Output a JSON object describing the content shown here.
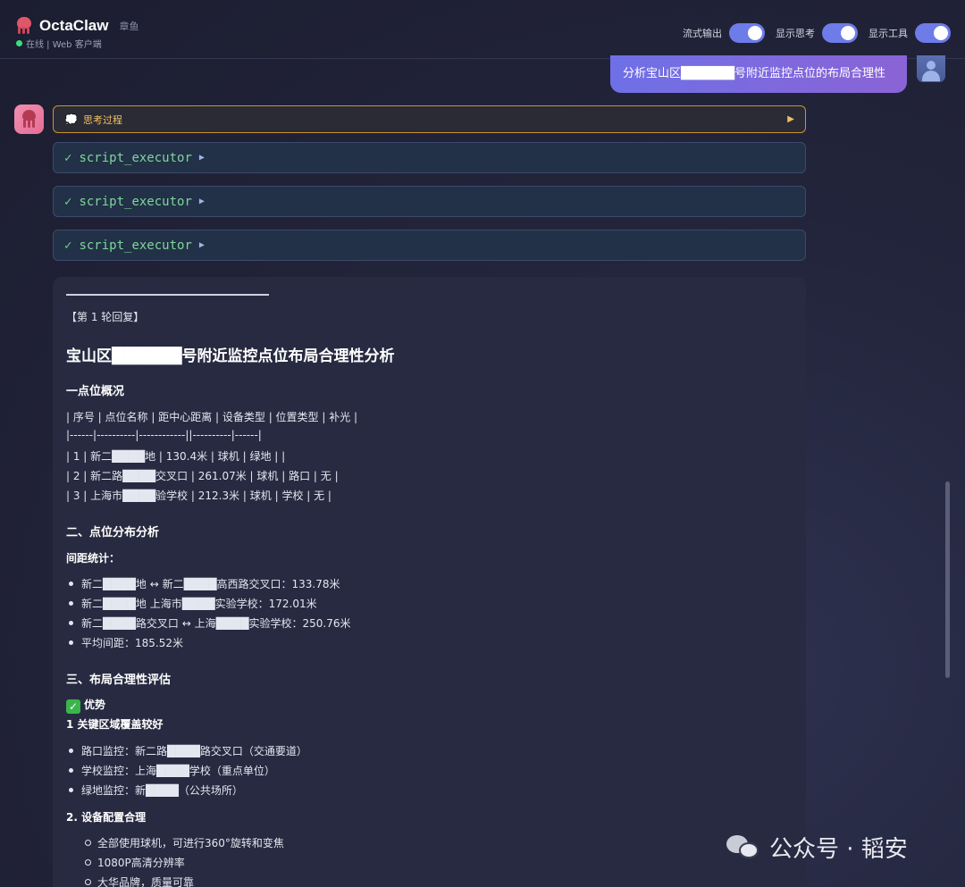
{
  "header": {
    "title": "OctaClaw",
    "subtitle": "章鱼",
    "status": "在线 | Web 客户端",
    "toggles": [
      {
        "label": "流式输出",
        "on": true
      },
      {
        "label": "显示思考",
        "on": true
      },
      {
        "label": "显示工具",
        "on": true
      }
    ]
  },
  "user_message": {
    "text": "分析宝山区██████号附近监控点位的布局合理性"
  },
  "thinking": {
    "label": "思考过程",
    "arrow": "▶"
  },
  "tools": [
    {
      "check": "✓",
      "name": "script_executor",
      "arrow": "▶"
    },
    {
      "check": "✓",
      "name": "script_executor",
      "arrow": "▶"
    },
    {
      "check": "✓",
      "name": "script_executor",
      "arrow": "▶"
    }
  ],
  "response": {
    "round_label": "【第 1 轮回复】",
    "title": "宝山区██████号附近监控点位布局合理性分析",
    "section1": {
      "heading": "一点位概况",
      "table_lines": [
        "| 序号 | 点位名称 | 距中心距离 | 设备类型 | 位置类型 | 补光 |",
        "|------|----------|------------||----------|------|",
        "| 1 | 新二████地 | 130.4米 | 球机 | 绿地 | |",
        "| 2 | 新二路████交叉口 | 261.07米 | 球机 | 路口 | 无 |",
        "| 3 | 上海市████验学校 | 212.3米 | 球机 | 学校 | 无 |"
      ]
    },
    "section2": {
      "heading": "二、点位分布分析",
      "sub": "间距统计：",
      "items": [
        "新二████地 ↔ 新二████高西路交叉口：133.78米",
        "新二████地 上海市████实验学校：172.01米",
        "新二████路交叉口 ↔ 上海████实验学校：250.76米",
        "平均间距：185.52米"
      ]
    },
    "section3": {
      "heading": "三、布局合理性评估",
      "advantage_label": "优势",
      "sub1": "1 关键区域覆盖较好",
      "items1": [
        "路口监控：新二路████路交叉口（交通要道）",
        "学校监控：上海████学校（重点单位）",
        "绿地监控：新████（公共场所）"
      ],
      "sub2": "2.  设备配置合理",
      "items2": [
        "全部使用球机，可进行360°旋转和变焦",
        "1080P高清分辨率",
        "大华品牌，质量可靠"
      ]
    }
  },
  "watermark": {
    "text": "公众号 · 韬安"
  }
}
